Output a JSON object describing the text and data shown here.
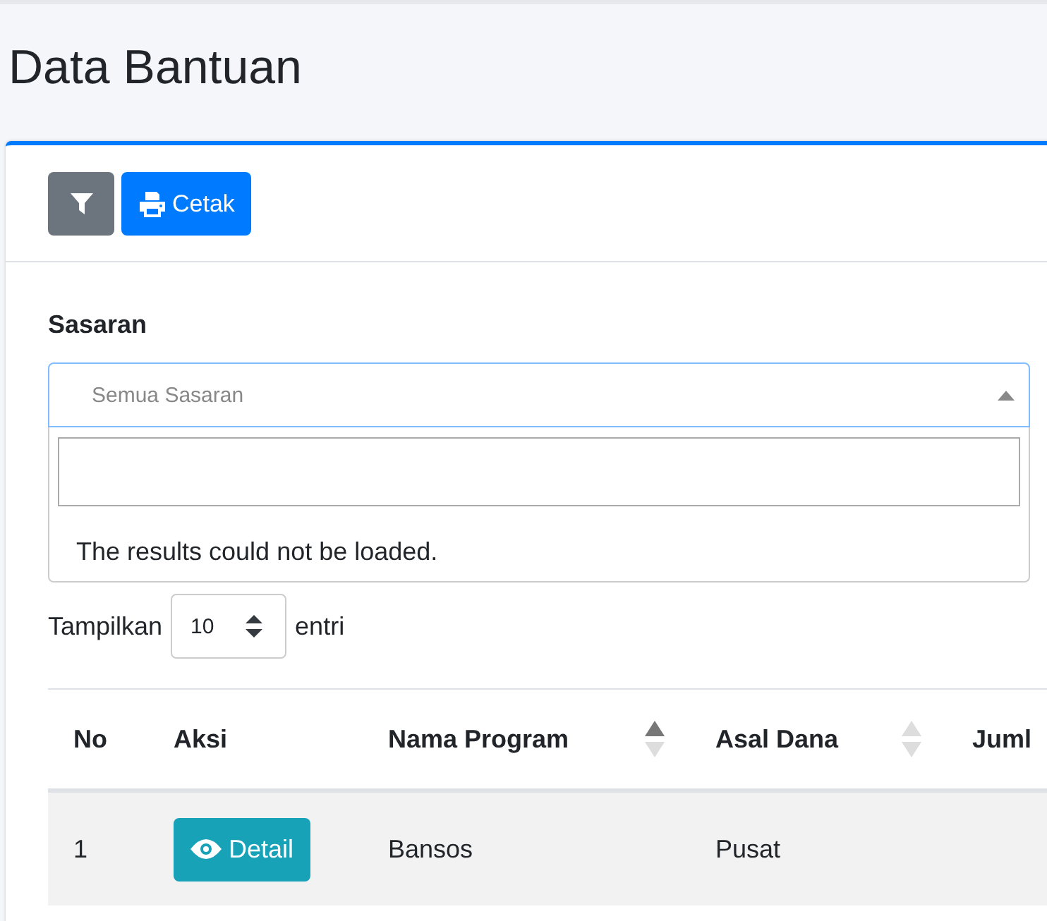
{
  "page_title": "Data Bantuan",
  "toolbar": {
    "print_button": "Cetak"
  },
  "filter": {
    "label": "Sasaran",
    "select_value": "Semua Sasaran",
    "expanded": true,
    "message": "The results could not be loaded."
  },
  "length": {
    "before": "Tampilkan",
    "value": "10",
    "after": "entri"
  },
  "table": {
    "columns": [
      {
        "label": "No",
        "kind": "plain"
      },
      {
        "label": "Aksi",
        "kind": "plain"
      },
      {
        "label": "Nama Program",
        "kind": "sortable",
        "sorted": true
      },
      {
        "label": "Asal Dana",
        "kind": "sortable",
        "sorted": false
      },
      {
        "label": "Juml",
        "kind": "plain"
      }
    ],
    "rows": [
      {
        "no": "1",
        "action": "Detail",
        "program": "Bansos",
        "fund": "Pusat"
      }
    ]
  }
}
